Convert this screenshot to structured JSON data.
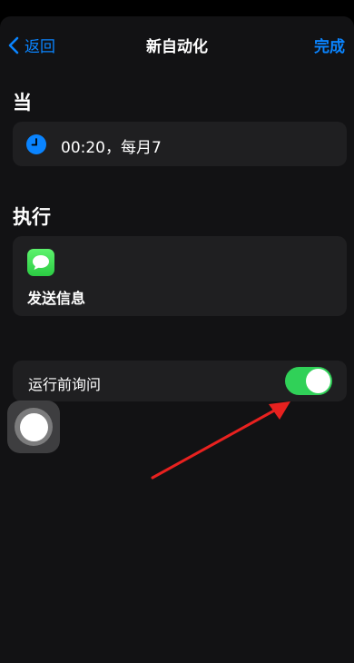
{
  "nav": {
    "back_label": "返回",
    "title": "新自动化",
    "done_label": "完成"
  },
  "when": {
    "section_title": "当",
    "trigger_text": "00:20，每月7",
    "icon": "clock-icon"
  },
  "do": {
    "section_title": "执行",
    "action_label": "发送信息",
    "icon": "messages-icon"
  },
  "ask_before_running": {
    "label": "运行前询问",
    "enabled": true
  },
  "colors": {
    "accent": "#0a84ff",
    "toggle_on": "#30d158",
    "annotation_arrow": "#e8211f"
  }
}
